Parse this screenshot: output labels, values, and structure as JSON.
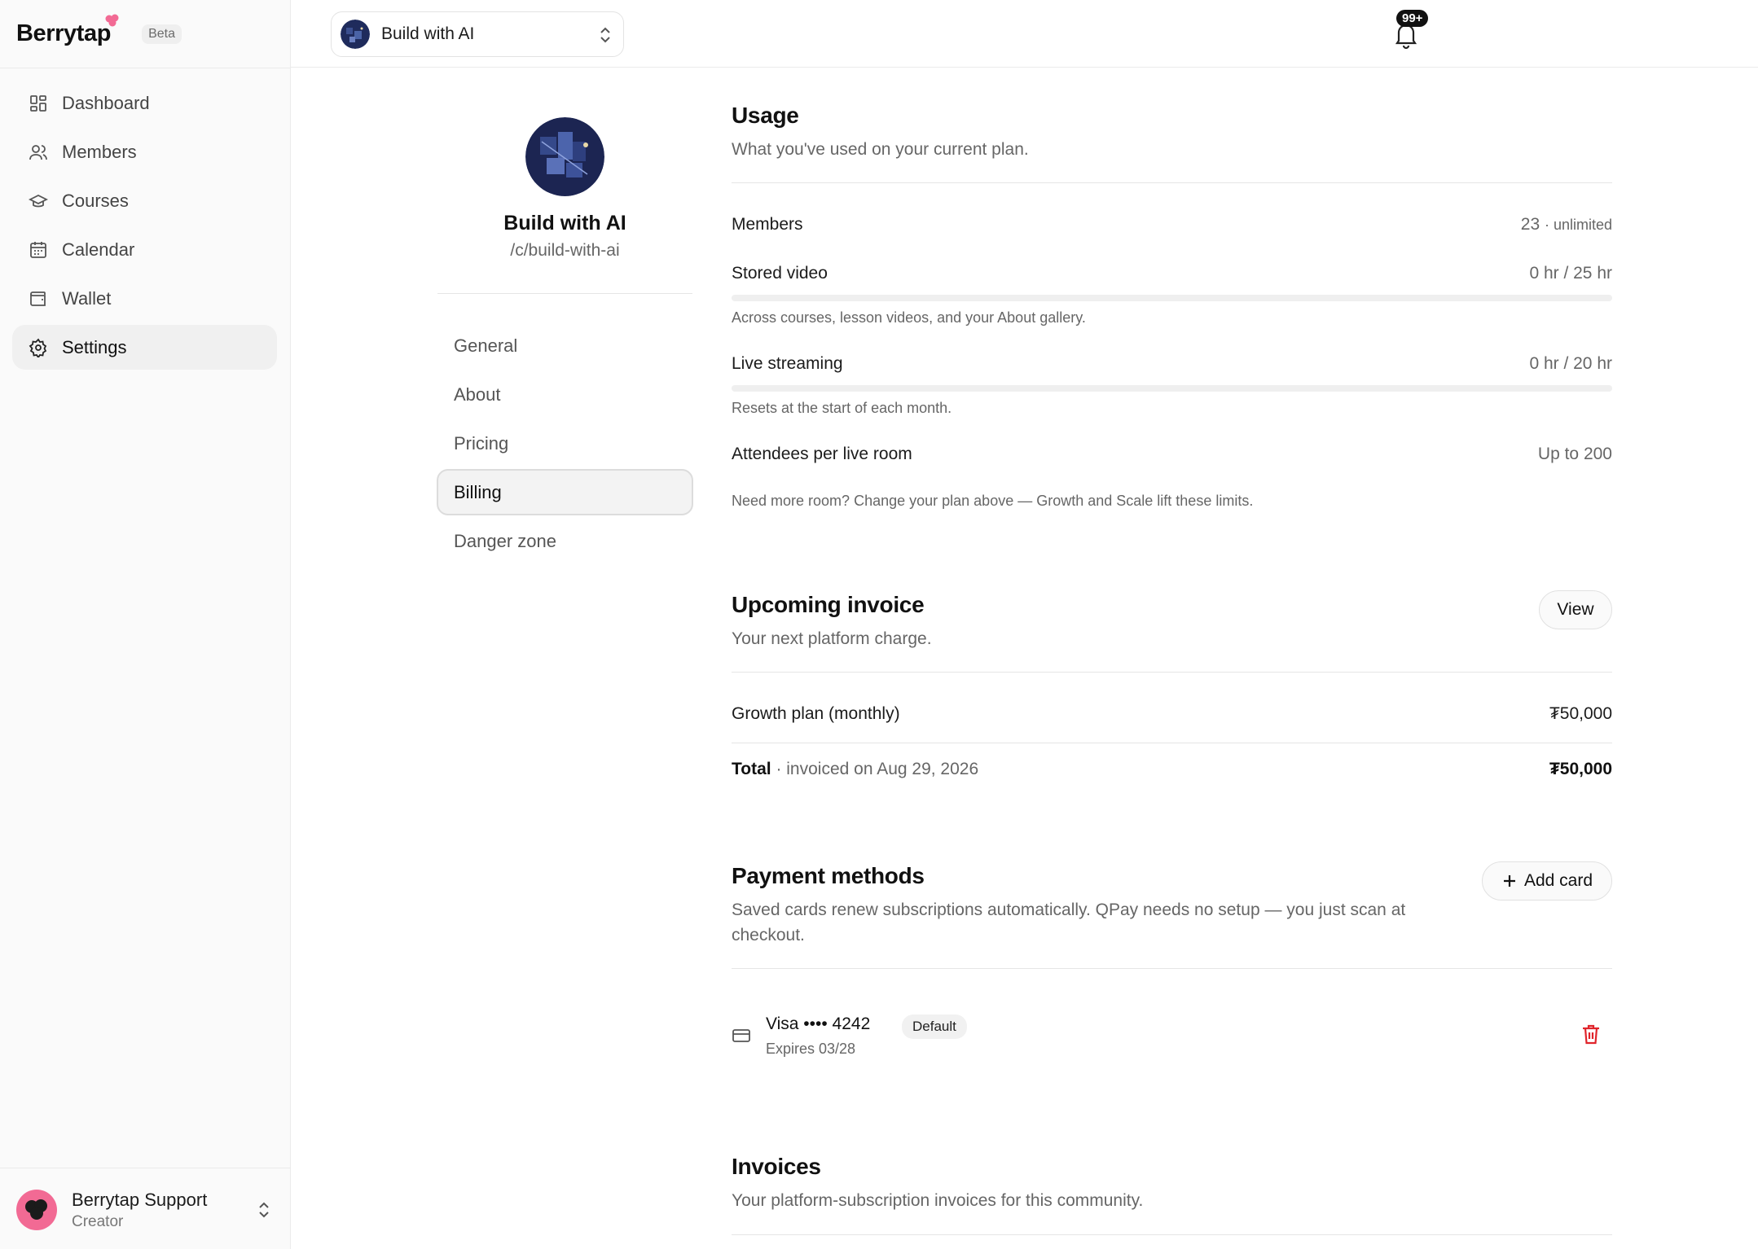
{
  "brand": {
    "name": "Berrytap",
    "badge": "Beta"
  },
  "sidebar": {
    "items": [
      {
        "label": "Dashboard",
        "icon": "dashboard-icon"
      },
      {
        "label": "Members",
        "icon": "users-icon"
      },
      {
        "label": "Courses",
        "icon": "graduation-cap-icon"
      },
      {
        "label": "Calendar",
        "icon": "calendar-icon"
      },
      {
        "label": "Wallet",
        "icon": "wallet-icon"
      },
      {
        "label": "Settings",
        "icon": "gear-icon",
        "active": true
      }
    ]
  },
  "profile": {
    "name": "Berrytap Support",
    "role": "Creator"
  },
  "topbar": {
    "community_switcher": "Build with AI",
    "notification_badge": "99+"
  },
  "community": {
    "name": "Build with AI",
    "slug": "/c/build-with-ai"
  },
  "settings_nav": {
    "items": [
      {
        "label": "General"
      },
      {
        "label": "About"
      },
      {
        "label": "Pricing"
      },
      {
        "label": "Billing",
        "active": true
      },
      {
        "label": "Danger zone"
      }
    ]
  },
  "usage": {
    "title": "Usage",
    "subtitle": "What you've used on your current plan.",
    "members": {
      "label": "Members",
      "value": "23",
      "limit": "· unlimited"
    },
    "stored_video": {
      "label": "Stored video",
      "value": "0 hr / 25 hr",
      "note": "Across courses, lesson videos, and your About gallery.",
      "used_fraction": 0
    },
    "live_streaming": {
      "label": "Live streaming",
      "value": "0 hr / 20 hr",
      "note": "Resets at the start of each month.",
      "used_fraction": 0
    },
    "attendees": {
      "label": "Attendees per live room",
      "value": "Up to 200"
    },
    "footer_note": "Need more room? Change your plan above — Growth and Scale lift these limits."
  },
  "upcoming_invoice": {
    "title": "Upcoming invoice",
    "subtitle": "Your next platform charge.",
    "view_label": "View",
    "line_label": "Growth plan (monthly)",
    "line_amount": "₮50,000",
    "total_label": "Total",
    "total_rest": " · invoiced on Aug 29, 2026",
    "total_amount": "₮50,000"
  },
  "payment_methods": {
    "title": "Payment methods",
    "subtitle": "Saved cards renew subscriptions automatically. QPay needs no setup — you just scan at checkout.",
    "add_label": "Add card",
    "card": {
      "name": "Visa •••• 4242",
      "badge": "Default",
      "expires": "Expires 03/28"
    }
  },
  "invoices": {
    "title": "Invoices",
    "subtitle": "Your platform-subscription invoices for this community."
  },
  "colors": {
    "brand_pink": "#f26a94",
    "danger": "#e0242b",
    "active_bg": "#f0f0f0"
  }
}
